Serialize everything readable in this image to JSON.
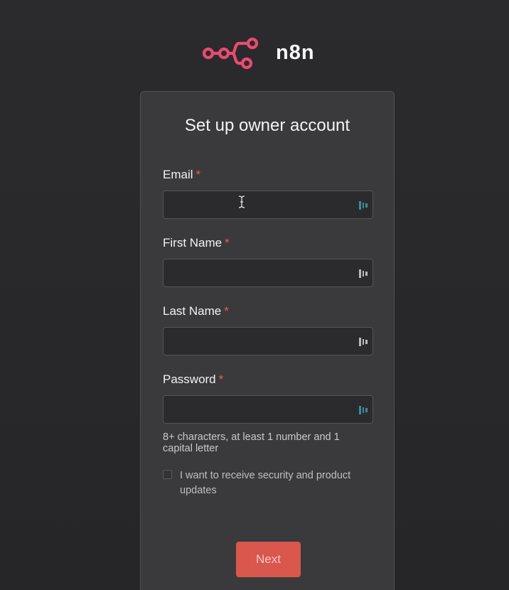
{
  "brand": {
    "name": "n8n",
    "logo_icon": "n8n-logo-icon",
    "logo_color": "#ea4b71"
  },
  "form": {
    "title": "Set up owner account",
    "required_marker": "*",
    "fields": [
      {
        "label": "Email",
        "value": "",
        "icon": "password-manager-icon",
        "icon_color": "#3c8b9a"
      },
      {
        "label": "First Name",
        "value": "",
        "icon": "password-manager-icon",
        "icon_color": "#b9b9bb"
      },
      {
        "label": "Last Name",
        "value": "",
        "icon": "password-manager-icon",
        "icon_color": "#b9b9bb"
      },
      {
        "label": "Password",
        "value": "",
        "icon": "password-manager-icon",
        "icon_color": "#3c8b9a"
      }
    ],
    "password_hint": "8+ characters, at least 1 number and 1 capital letter",
    "consent": {
      "label": "I want to receive security and product updates",
      "checked": false
    },
    "next_label": "Next"
  },
  "colors": {
    "background": "#2a2a2c",
    "card": "#3a3a3c",
    "input": "#2b2b2d",
    "required": "#ea5a5a",
    "button": "#d9574d"
  }
}
